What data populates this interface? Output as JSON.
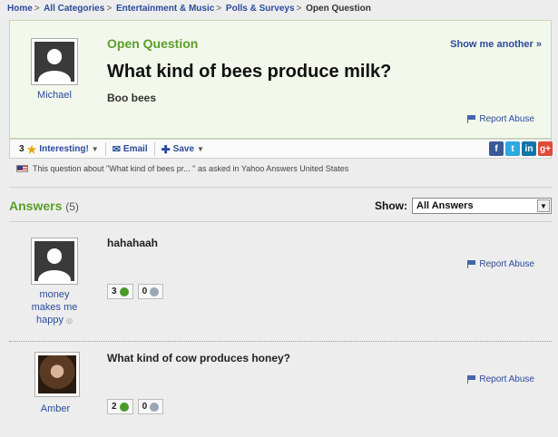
{
  "breadcrumb": {
    "items": [
      "Home",
      "All Categories",
      "Entertainment & Music",
      "Polls & Surveys"
    ],
    "current": "Open Question",
    "separator": ">"
  },
  "question": {
    "status_label": "Open Question",
    "show_another": "Show me another »",
    "title": "What kind of bees produce milk?",
    "detail": "Boo bees",
    "asker": "Michael",
    "report_abuse": "Report Abuse"
  },
  "question_bar": {
    "interesting_count": "3",
    "interesting_label": "Interesting!",
    "email_label": "Email",
    "save_label": "Save",
    "social_icons": [
      "facebook-icon",
      "twitter-icon",
      "linkedin-icon",
      "google-plus-icon"
    ],
    "social_glyphs": [
      "f",
      "t",
      "in",
      "g+"
    ]
  },
  "origin_note": "This question about \"What kind of bees pr... \" as asked in Yahoo Answers United States",
  "answers": {
    "heading": "Answers",
    "count": "(5)",
    "show_label": "Show:",
    "filter_value": "All Answers",
    "items": [
      {
        "author_line1": "money",
        "author_line2": "makes me",
        "author_line3": "happy",
        "text": "hahahaah",
        "thumbs_up": "3",
        "thumbs_down": "0",
        "report_abuse": "Report Abuse"
      },
      {
        "author_line1": "Amber",
        "text": "What kind of cow produces honey?",
        "thumbs_up": "2",
        "thumbs_down": "0",
        "report_abuse": "Report Abuse"
      }
    ]
  },
  "colors": {
    "accent_green": "#5a9e2a",
    "link_blue": "#2a4a9a",
    "question_bg": "#f3f8ec"
  }
}
